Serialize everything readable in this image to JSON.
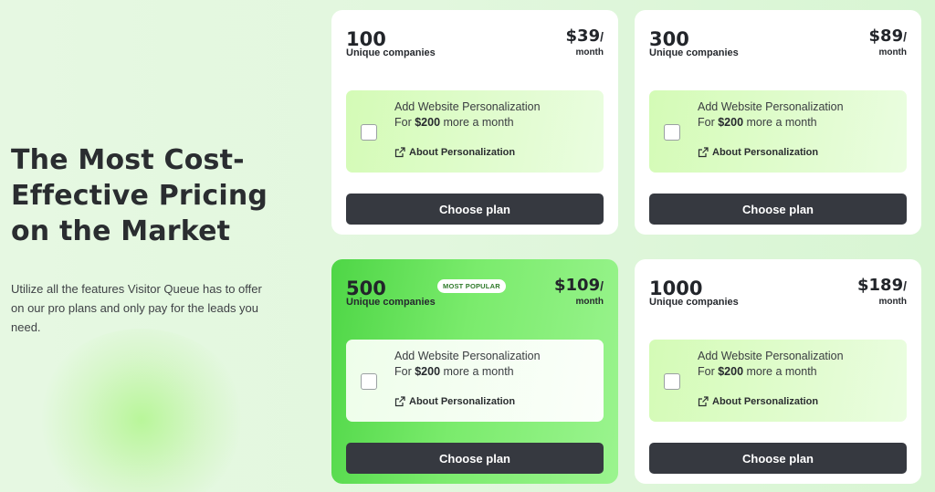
{
  "hero": {
    "title_line1": "The Most Cost-",
    "title_line2": "Effective Pricing",
    "title_line3": "on the Market",
    "description": "Utilize all the features Visitor Queue has to offer on our pro plans and only pay for the leads you need."
  },
  "plans": [
    {
      "quantity": "100",
      "unit": "Unique companies",
      "price": "$39",
      "slash": "/",
      "period": "month",
      "addon_title": "Add Website Personalization",
      "addon_prefix": "For ",
      "addon_amount": "$200",
      "addon_suffix": " more a month",
      "addon_link": "About Personalization",
      "button": "Choose plan"
    },
    {
      "quantity": "300",
      "unit": "Unique companies",
      "price": "$89",
      "slash": "/",
      "period": "month",
      "addon_title": "Add Website Personalization",
      "addon_prefix": "For ",
      "addon_amount": "$200",
      "addon_suffix": " more a month",
      "addon_link": "About Personalization",
      "button": "Choose plan"
    },
    {
      "quantity": "500",
      "unit": "Unique companies",
      "price": "$109",
      "slash": "/",
      "period": "month",
      "badge": "MOST POPULAR",
      "addon_title": "Add Website Personalization",
      "addon_prefix": "For ",
      "addon_amount": "$200",
      "addon_suffix": " more a month",
      "addon_link": "About Personalization",
      "button": "Choose plan"
    },
    {
      "quantity": "1000",
      "unit": "Unique companies",
      "price": "$189",
      "slash": "/",
      "period": "month",
      "addon_title": "Add Website Personalization",
      "addon_prefix": "For ",
      "addon_amount": "$200",
      "addon_suffix": " more a month",
      "addon_link": "About Personalization",
      "button": "Choose plan"
    }
  ],
  "colors": {
    "popular_card": "#5fe053",
    "button": "#363940",
    "background": "#e2f7de"
  }
}
